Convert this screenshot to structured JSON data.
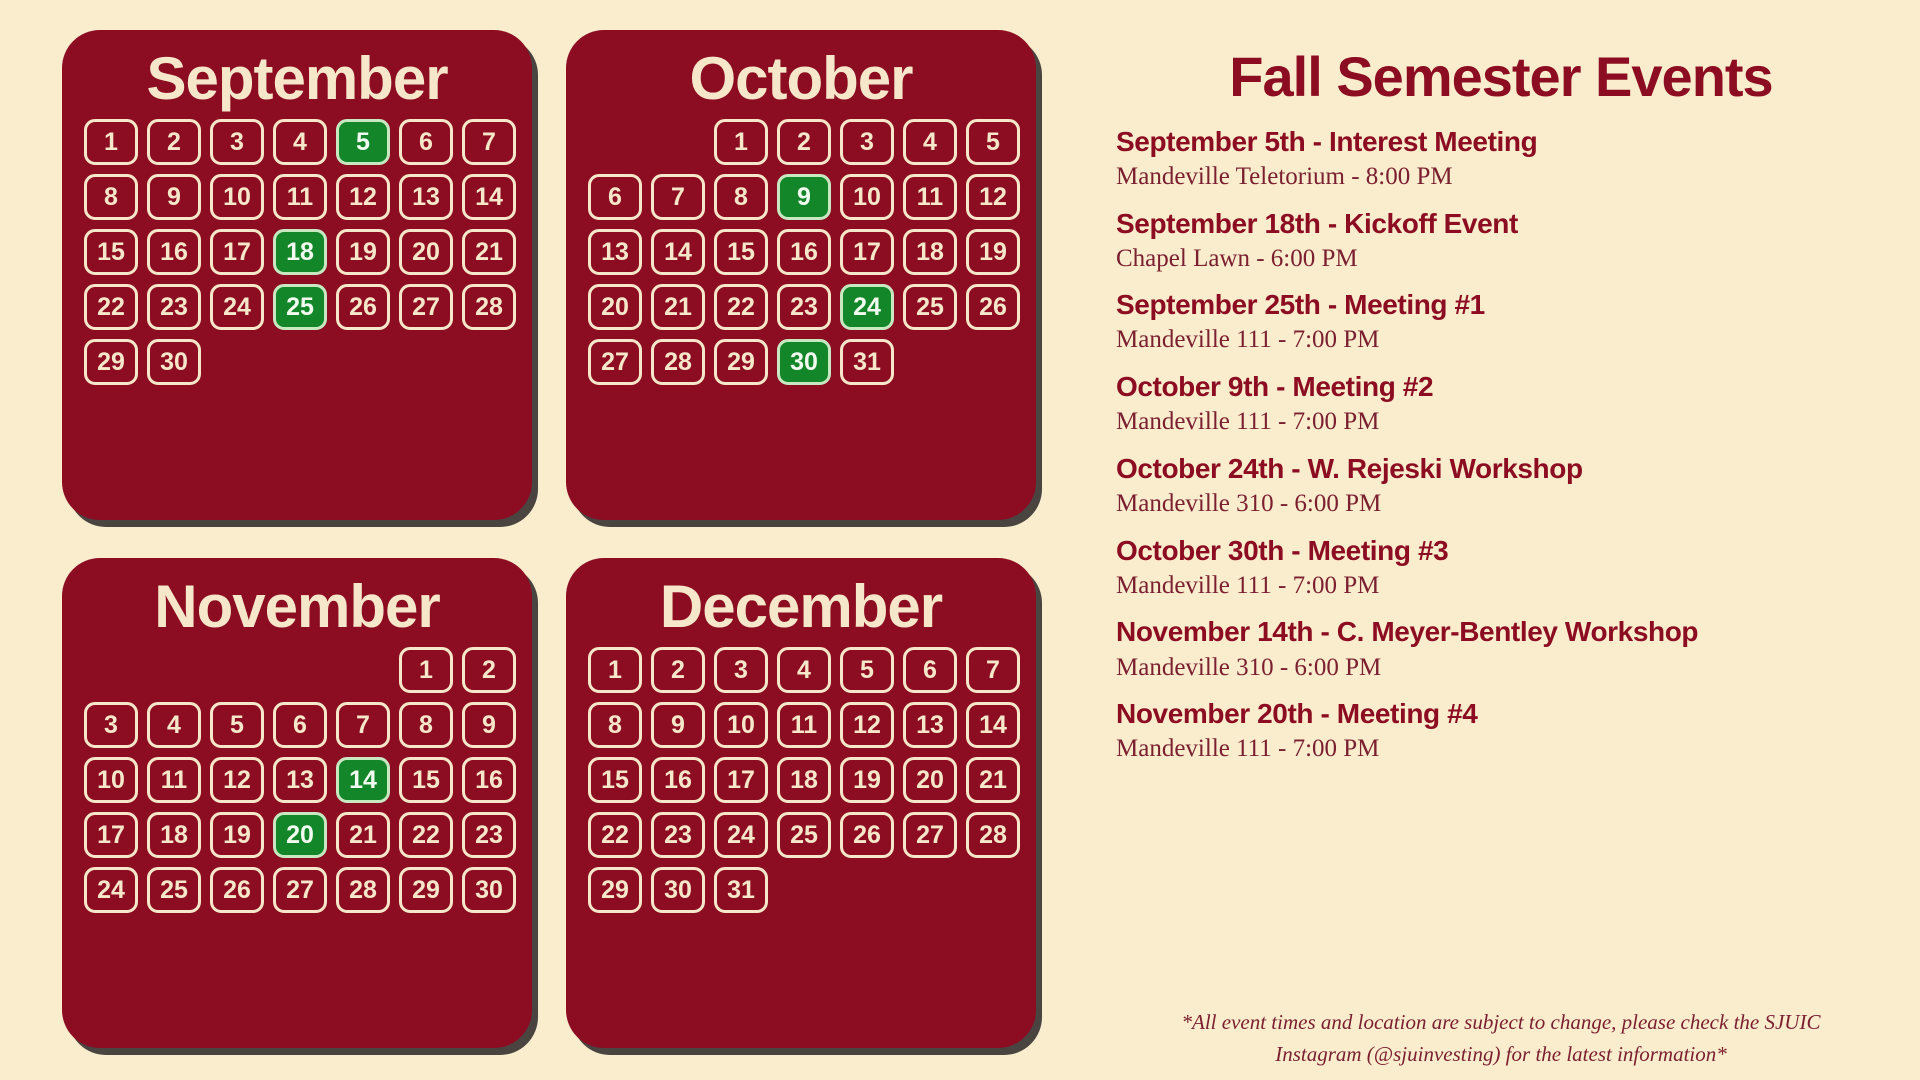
{
  "theme": {
    "background": "#FAEDCD",
    "card_red": "#8C0D22",
    "cream": "#F7E7CA",
    "event_green": "#13862A",
    "detail_text": "#7A2030"
  },
  "calendars": [
    {
      "name": "September",
      "leading_blanks": 0,
      "days_in_month": 30,
      "event_days": [
        5,
        18,
        25
      ]
    },
    {
      "name": "October",
      "leading_blanks": 2,
      "days_in_month": 31,
      "event_days": [
        9,
        24,
        30
      ]
    },
    {
      "name": "November",
      "leading_blanks": 5,
      "days_in_month": 30,
      "event_days": [
        14,
        20
      ]
    },
    {
      "name": "December",
      "leading_blanks": 0,
      "days_in_month": 31,
      "event_days": []
    }
  ],
  "events_panel": {
    "title": "Fall Semester Events",
    "items": [
      {
        "name": "September 5th - Interest Meeting",
        "detail": "Mandeville Teletorium - 8:00 PM"
      },
      {
        "name": "September 18th - Kickoff Event",
        "detail": "Chapel Lawn - 6:00 PM"
      },
      {
        "name": "September 25th - Meeting #1",
        "detail": "Mandeville 111 - 7:00 PM"
      },
      {
        "name": "October 9th - Meeting #2",
        "detail": "Mandeville 111 - 7:00 PM"
      },
      {
        "name": "October 24th - W. Rejeski Workshop",
        "detail": "Mandeville 310 - 6:00 PM"
      },
      {
        "name": "October 30th - Meeting #3",
        "detail": "Mandeville 111 - 7:00 PM"
      },
      {
        "name": "November 14th - C. Meyer-Bentley Workshop",
        "detail": "Mandeville 310 - 6:00 PM"
      },
      {
        "name": "November 20th - Meeting #4",
        "detail": "Mandeville 111 - 7:00 PM"
      }
    ],
    "note": "*All event times and location are subject to change, please check the SJUIC Instagram (@sjuinvesting) for the latest information*"
  }
}
